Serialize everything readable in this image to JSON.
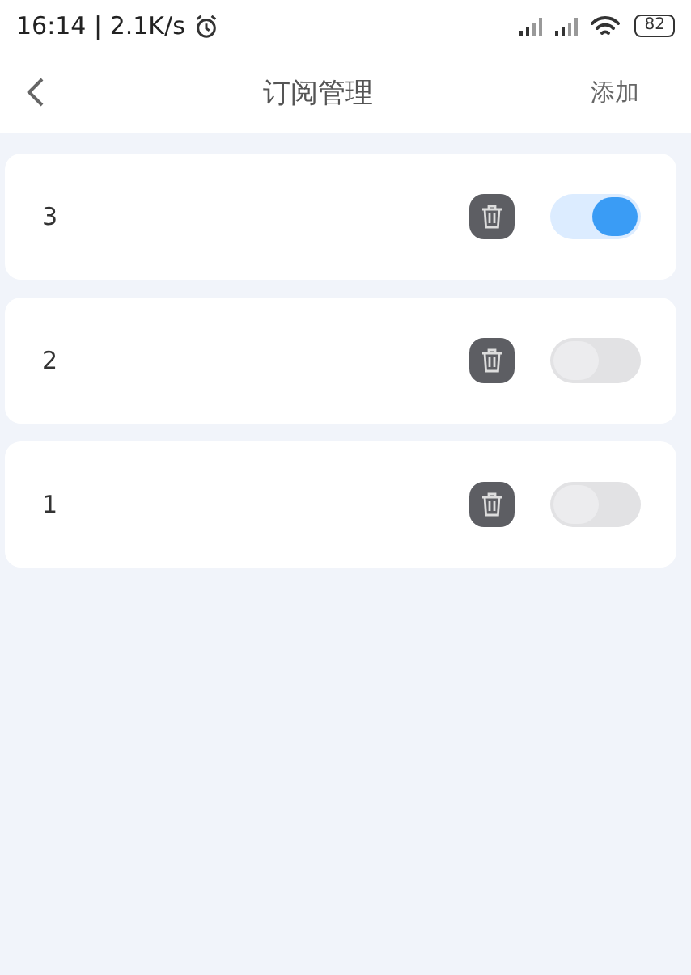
{
  "status_bar": {
    "time": "16:14 | 2.1K/s",
    "battery": "82"
  },
  "nav": {
    "title": "订阅管理",
    "action": "添加"
  },
  "subscriptions": [
    {
      "name": "3",
      "on": true
    },
    {
      "name": "2",
      "on": false
    },
    {
      "name": "1",
      "on": false
    }
  ]
}
